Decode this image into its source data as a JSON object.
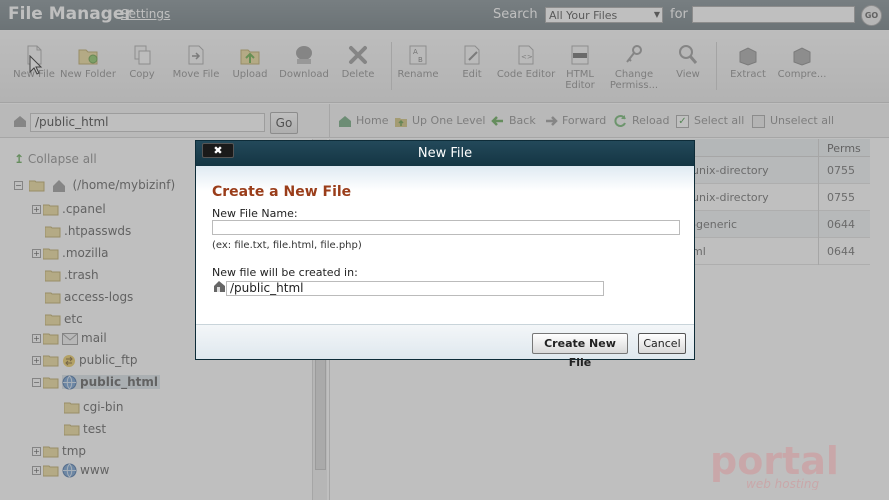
{
  "header": {
    "title": "File Manager",
    "settings_label": "Settings",
    "search_label": "Search",
    "search_scope": "All Your Files",
    "for_label": "for",
    "search_value": "",
    "go_label": "GO"
  },
  "toolbar": {
    "new_file": "New File",
    "new_folder": "New Folder",
    "copy": "Copy",
    "move_file": "Move File",
    "upload": "Upload",
    "download": "Download",
    "delete": "Delete",
    "rename": "Rename",
    "edit": "Edit",
    "code_editor": "Code Editor",
    "html_editor": "HTML Editor",
    "change_permissions": "Change Permiss...",
    "view": "View",
    "extract": "Extract",
    "compress": "Compre..."
  },
  "pathbar": {
    "path": "/public_html",
    "go_label": "Go"
  },
  "nav": {
    "home": "Home",
    "up_one_level": "Up One Level",
    "back": "Back",
    "forward": "Forward",
    "reload": "Reload",
    "select_all": "Select all",
    "unselect_all": "Unselect all"
  },
  "tree": {
    "collapse_all": "Collapse all",
    "root": "(/home/mybizinf)",
    "items": [
      {
        "label": ".cpanel"
      },
      {
        "label": ".htpasswds"
      },
      {
        "label": ".mozilla"
      },
      {
        "label": ".trash"
      },
      {
        "label": "access-logs"
      },
      {
        "label": "etc"
      },
      {
        "label": "mail"
      },
      {
        "label": "public_ftp"
      },
      {
        "label": "public_html"
      },
      {
        "label": "cgi-bin"
      },
      {
        "label": "test"
      },
      {
        "label": "tmp"
      },
      {
        "label": "www"
      }
    ]
  },
  "listing": {
    "perms_header": "Perms",
    "rows": [
      {
        "type": "unix-directory",
        "perms": "0755"
      },
      {
        "type": "unix-directory",
        "perms": "0755"
      },
      {
        "type": "-generic",
        "perms": "0644"
      },
      {
        "type": "ml",
        "perms": "0644"
      }
    ]
  },
  "dialog": {
    "title": "New File",
    "close_label": "✖",
    "heading": "Create a New File",
    "name_label": "New File Name:",
    "name_value": "",
    "hint": "(ex: file.txt, file.html, file.php)",
    "location_label": "New file will be created in:",
    "location_value": "/public_html",
    "create_label": "Create New File",
    "cancel_label": "Cancel"
  },
  "watermark": {
    "brand": "portal",
    "sub": "web hosting"
  }
}
